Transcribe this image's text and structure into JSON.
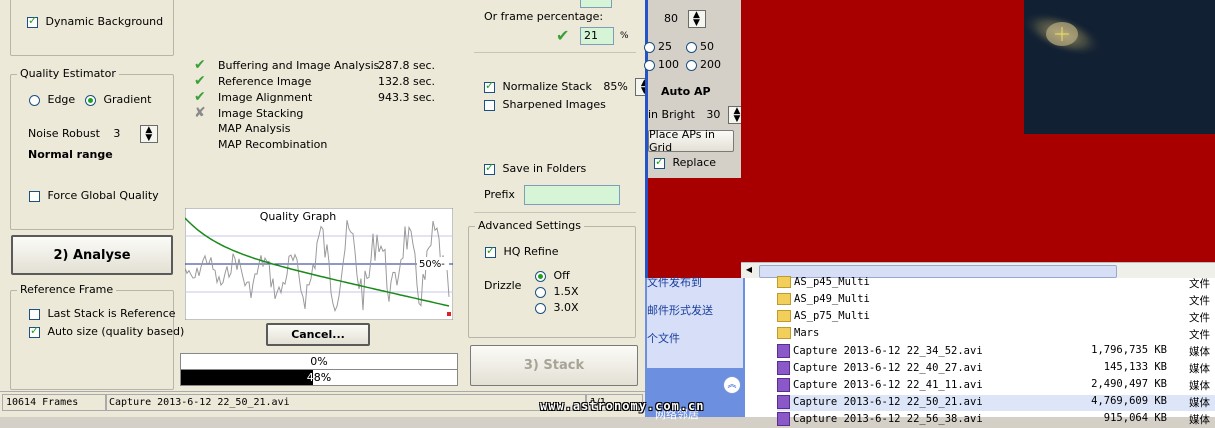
{
  "quality_panel": {
    "dynamic_background": "Dynamic Background",
    "quality_estimator_title": "Quality Estimator",
    "edge": "Edge",
    "gradient": "Gradient",
    "noise_robust": "Noise Robust",
    "noise_robust_value": "3",
    "normal_range": "Normal range",
    "force_global_quality": "Force Global Quality"
  },
  "analyse_button": "2) Analyse",
  "reference_frame": {
    "title": "Reference Frame",
    "last_stack": "Last Stack is Reference",
    "auto_size": "Auto size (quality based)"
  },
  "progress_steps": [
    {
      "label": "Buffering and Image Analysis",
      "time": "287.8 sec.",
      "status": "done"
    },
    {
      "label": "Reference Image",
      "time": "132.8 sec.",
      "status": "done"
    },
    {
      "label": "Image Alignment",
      "time": "943.3 sec.",
      "status": "done"
    },
    {
      "label": "Image Stacking",
      "time": "",
      "status": "active"
    },
    {
      "label": "MAP Analysis",
      "time": "",
      "status": "pending"
    },
    {
      "label": "MAP Recombination",
      "time": "",
      "status": "pending"
    }
  ],
  "graph": {
    "title": "Quality Graph",
    "marker": "50%-"
  },
  "cancel_button": "Cancel...",
  "progress": {
    "bar1_text": "0%",
    "bar1_value": 0,
    "bar2_text": "48%",
    "bar2_value": 48
  },
  "stack_panel": {
    "frame_percentage_label": "Or frame percentage:",
    "frame_percentage_value": "21",
    "percent_sign": "%",
    "normalize_stack": "Normalize Stack",
    "normalize_value": "85%",
    "sharpened_images": "Sharpened Images",
    "save_in_folders": "Save in Folders",
    "prefix_label": "Prefix",
    "prefix_value": ""
  },
  "advanced": {
    "title": "Advanced Settings",
    "hq_refine": "HQ Refine",
    "drizzle_label": "Drizzle",
    "drizzle_off": "Off",
    "drizzle_15": "1.5X",
    "drizzle_30": "3.0X"
  },
  "stack_button": "3) Stack",
  "status_bar": {
    "frames": "10614 Frames",
    "file": "Capture 2013-6-12 22_50_21.avi",
    "page": "1/1"
  },
  "ap_panel": {
    "size_value": "80",
    "sizes": [
      "25",
      "50",
      "100",
      "200"
    ],
    "auto_ap_title": "Auto AP",
    "min_bright_label": "in Bright",
    "min_bright_value": "30",
    "place_aps_button": "Place APs in Grid",
    "replace": "Replace"
  },
  "explorer": {
    "left_links": [
      "文件发布到",
      "邮件形式发送",
      "个文件"
    ],
    "files": [
      {
        "name": "AS_p45_Multi",
        "size": "",
        "type": "文件",
        "kind": "folder"
      },
      {
        "name": "AS_p49_Multi",
        "size": "",
        "type": "文件",
        "kind": "folder"
      },
      {
        "name": "AS_p75_Multi",
        "size": "",
        "type": "文件",
        "kind": "folder"
      },
      {
        "name": "Mars",
        "size": "",
        "type": "文件",
        "kind": "folder"
      },
      {
        "name": "Capture 2013-6-12 22_34_52.avi",
        "size": "1,796,735 KB",
        "type": "媒体",
        "kind": "avi"
      },
      {
        "name": "Capture 2013-6-12 22_40_27.avi",
        "size": "145,133 KB",
        "type": "媒体",
        "kind": "avi"
      },
      {
        "name": "Capture 2013-6-12 22_41_11.avi",
        "size": "2,490,497 KB",
        "type": "媒体",
        "kind": "avi"
      },
      {
        "name": "Capture 2013-6-12 22_50_21.avi",
        "size": "4,769,609 KB",
        "type": "媒体",
        "kind": "avi"
      },
      {
        "name": "Capture 2013-6-12 22_56_38.avi",
        "size": "915,064 KB",
        "type": "媒体",
        "kind": "avi"
      }
    ],
    "bottom_left": "网络邻居"
  },
  "watermark": "www.astronomy.com.cn",
  "colors": {
    "red_background": "#a80000",
    "graph_green": "#1a8a1a",
    "accent_blue": "#2453c8"
  }
}
